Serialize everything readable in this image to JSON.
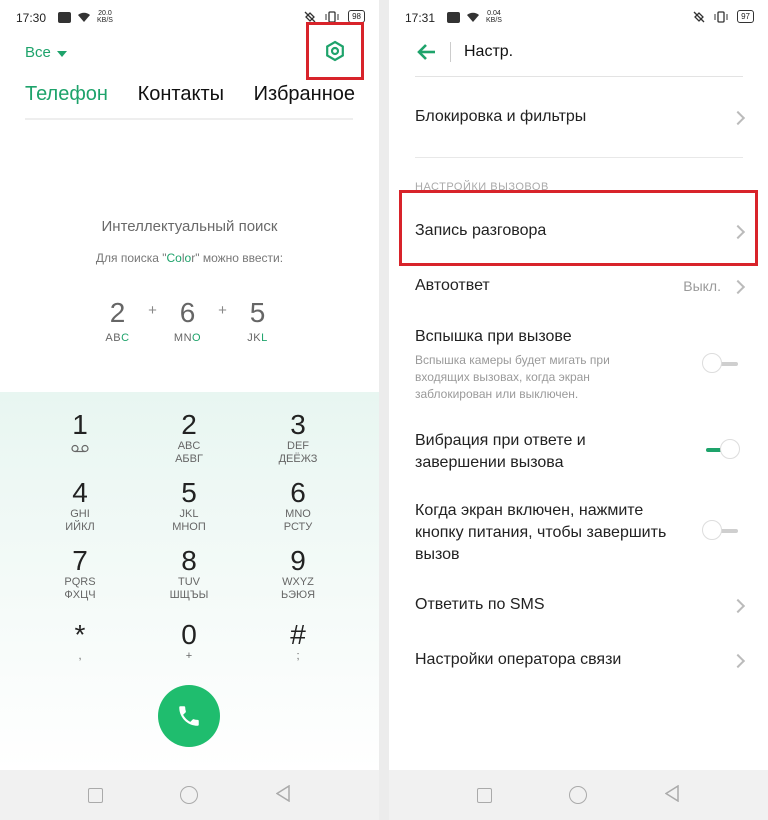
{
  "left": {
    "status": {
      "time": "17:30",
      "speed_value": "20.0",
      "speed_unit": "KB/S",
      "battery": "98"
    },
    "filter_label": "Все",
    "tabs": [
      "Телефон",
      "Контакты",
      "Избранное"
    ],
    "smart_search_title": "Интеллектуальный поиск",
    "hint_prefix": "Для поиска \"",
    "hint_co": "Co",
    "hint_l": "l",
    "hint_o": "o",
    "hint_r": "r",
    "hint_suffix": "\" можно ввести:",
    "example": [
      {
        "digit": "2",
        "letters_a": "AB",
        "letters_b": "C"
      },
      {
        "digit": "6",
        "letters_a": "MN",
        "letters_b": "O"
      },
      {
        "digit": "5",
        "letters_a": "JK",
        "letters_b": "L"
      }
    ],
    "plus": "+",
    "keys": [
      {
        "num": "1",
        "lat": "",
        "cyr": ""
      },
      {
        "num": "2",
        "lat": "ABC",
        "cyr": "АБВГ"
      },
      {
        "num": "3",
        "lat": "DEF",
        "cyr": "ДЕЁЖЗ"
      },
      {
        "num": "4",
        "lat": "GHI",
        "cyr": "ИЙКЛ"
      },
      {
        "num": "5",
        "lat": "JKL",
        "cyr": "МНОП"
      },
      {
        "num": "6",
        "lat": "MNO",
        "cyr": "РСТУ"
      },
      {
        "num": "7",
        "lat": "PQRS",
        "cyr": "ФХЦЧ"
      },
      {
        "num": "8",
        "lat": "TUV",
        "cyr": "ШЩЪЫ"
      },
      {
        "num": "9",
        "lat": "WXYZ",
        "cyr": "ЬЭЮЯ"
      },
      {
        "num": "*",
        "lat": ",",
        "cyr": ""
      },
      {
        "num": "0",
        "lat": "+",
        "cyr": ""
      },
      {
        "num": "#",
        "lat": ";",
        "cyr": ""
      }
    ],
    "colors": {
      "accent": "#1ea36b",
      "call": "#1fbd6e",
      "highlight": "#d8232a"
    }
  },
  "right": {
    "status": {
      "time": "17:31",
      "speed_value": "0.04",
      "speed_unit": "KB/S",
      "battery": "97"
    },
    "title": "Настр.",
    "rows": {
      "blocking": "Блокировка и фильтры",
      "section": "НАСТРОЙКИ ВЫЗОВОВ",
      "recording": "Запись разговора",
      "autoanswer": "Автоответ",
      "autoanswer_value": "Выкл.",
      "flash_title": "Вспышка при вызове",
      "flash_sub": "Вспышка камеры будет мигать при входящих вызовах, когда экран заблокирован или выключен.",
      "vibration": "Вибрация при ответе и завершении вызова",
      "power_end": "Когда экран включен, нажмите кнопку питания, чтобы завершить вызов",
      "sms_reply": "Ответить по SMS",
      "operator": "Настройки оператора связи"
    },
    "toggles": {
      "flash": false,
      "vibration": true,
      "power_end": false
    }
  }
}
